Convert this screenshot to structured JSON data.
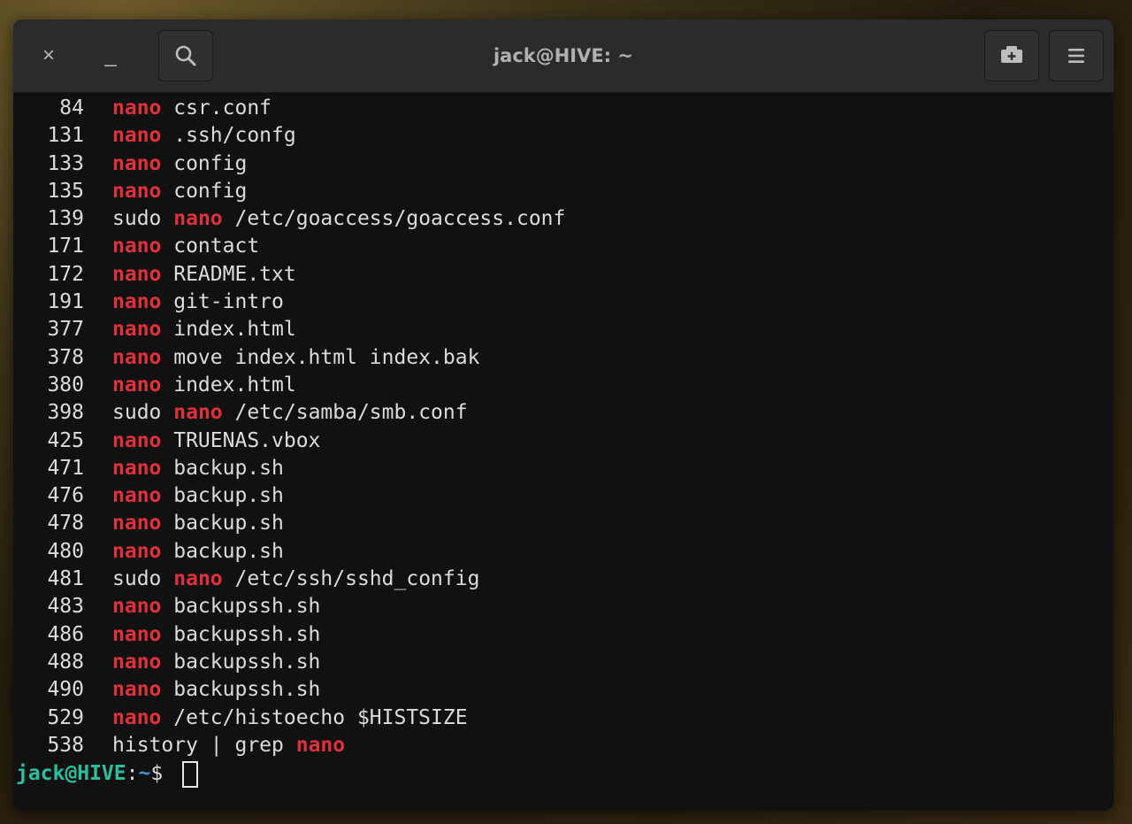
{
  "window": {
    "title": "jack@HIVE: ~",
    "close_glyph": "×",
    "minimize_glyph": "_"
  },
  "history": [
    {
      "num": "84",
      "parts": [
        {
          "t": "nano",
          "hl": true
        },
        {
          "t": " csr.conf",
          "hl": false
        }
      ]
    },
    {
      "num": "131",
      "parts": [
        {
          "t": "nano",
          "hl": true
        },
        {
          "t": " .ssh/confg",
          "hl": false
        }
      ]
    },
    {
      "num": "133",
      "parts": [
        {
          "t": "nano",
          "hl": true
        },
        {
          "t": " config",
          "hl": false
        }
      ]
    },
    {
      "num": "135",
      "parts": [
        {
          "t": "nano",
          "hl": true
        },
        {
          "t": " config",
          "hl": false
        }
      ]
    },
    {
      "num": "139",
      "parts": [
        {
          "t": "sudo ",
          "hl": false
        },
        {
          "t": "nano",
          "hl": true
        },
        {
          "t": " /etc/goaccess/goaccess.conf",
          "hl": false
        }
      ]
    },
    {
      "num": "171",
      "parts": [
        {
          "t": "nano",
          "hl": true
        },
        {
          "t": " contact",
          "hl": false
        }
      ]
    },
    {
      "num": "172",
      "parts": [
        {
          "t": "nano",
          "hl": true
        },
        {
          "t": " README.txt",
          "hl": false
        }
      ]
    },
    {
      "num": "191",
      "parts": [
        {
          "t": "nano",
          "hl": true
        },
        {
          "t": " git-intro",
          "hl": false
        }
      ]
    },
    {
      "num": "377",
      "parts": [
        {
          "t": "nano",
          "hl": true
        },
        {
          "t": " index.html",
          "hl": false
        }
      ]
    },
    {
      "num": "378",
      "parts": [
        {
          "t": "nano",
          "hl": true
        },
        {
          "t": " move index.html index.bak",
          "hl": false
        }
      ]
    },
    {
      "num": "380",
      "parts": [
        {
          "t": "nano",
          "hl": true
        },
        {
          "t": " index.html",
          "hl": false
        }
      ]
    },
    {
      "num": "398",
      "parts": [
        {
          "t": "sudo ",
          "hl": false
        },
        {
          "t": "nano",
          "hl": true
        },
        {
          "t": " /etc/samba/smb.conf",
          "hl": false
        }
      ]
    },
    {
      "num": "425",
      "parts": [
        {
          "t": "nano",
          "hl": true
        },
        {
          "t": " TRUENAS.vbox",
          "hl": false
        }
      ]
    },
    {
      "num": "471",
      "parts": [
        {
          "t": "nano",
          "hl": true
        },
        {
          "t": " backup.sh",
          "hl": false
        }
      ]
    },
    {
      "num": "476",
      "parts": [
        {
          "t": "nano",
          "hl": true
        },
        {
          "t": " backup.sh",
          "hl": false
        }
      ]
    },
    {
      "num": "478",
      "parts": [
        {
          "t": "nano",
          "hl": true
        },
        {
          "t": " backup.sh",
          "hl": false
        }
      ]
    },
    {
      "num": "480",
      "parts": [
        {
          "t": "nano",
          "hl": true
        },
        {
          "t": " backup.sh",
          "hl": false
        }
      ]
    },
    {
      "num": "481",
      "parts": [
        {
          "t": "sudo ",
          "hl": false
        },
        {
          "t": "nano",
          "hl": true
        },
        {
          "t": " /etc/ssh/sshd_config",
          "hl": false
        }
      ]
    },
    {
      "num": "483",
      "parts": [
        {
          "t": "nano",
          "hl": true
        },
        {
          "t": " backupssh.sh",
          "hl": false
        }
      ]
    },
    {
      "num": "486",
      "parts": [
        {
          "t": "nano",
          "hl": true
        },
        {
          "t": " backupssh.sh",
          "hl": false
        }
      ]
    },
    {
      "num": "488",
      "parts": [
        {
          "t": "nano",
          "hl": true
        },
        {
          "t": " backupssh.sh",
          "hl": false
        }
      ]
    },
    {
      "num": "490",
      "parts": [
        {
          "t": "nano",
          "hl": true
        },
        {
          "t": " backupssh.sh",
          "hl": false
        }
      ]
    },
    {
      "num": "529",
      "parts": [
        {
          "t": "nano",
          "hl": true
        },
        {
          "t": " /etc/histoecho $HISTSIZE",
          "hl": false
        }
      ]
    },
    {
      "num": "538",
      "parts": [
        {
          "t": "history | grep ",
          "hl": false
        },
        {
          "t": "nano",
          "hl": true
        }
      ]
    }
  ],
  "prompt": {
    "user_host": "jack@HIVE",
    "colon": ":",
    "path": "~",
    "symbol": "$ "
  },
  "colors": {
    "highlight": "#e0313b",
    "prompt_user": "#2bbf9e",
    "prompt_path": "#3a8fe8"
  }
}
